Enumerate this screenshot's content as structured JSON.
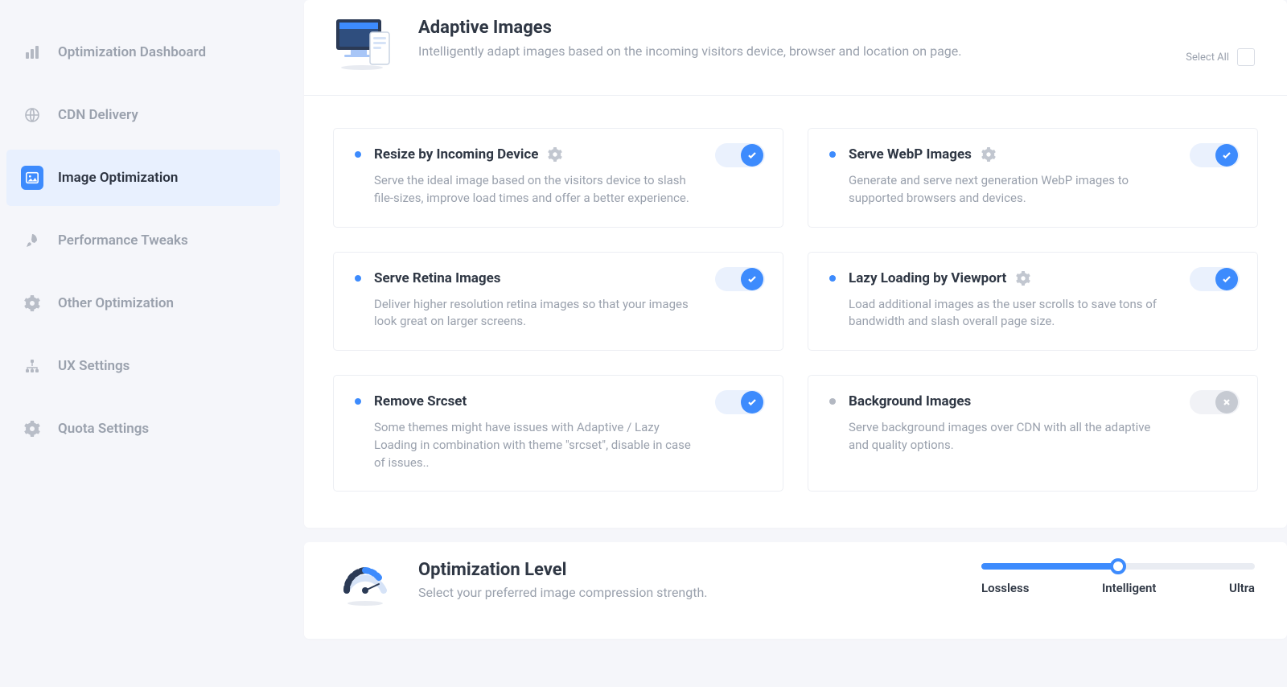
{
  "sidebar": {
    "items": [
      {
        "id": "dashboard",
        "label": "Optimization Dashboard",
        "icon": "bar-chart-icon"
      },
      {
        "id": "cdn",
        "label": "CDN Delivery",
        "icon": "globe-icon"
      },
      {
        "id": "image-opt",
        "label": "Image Optimization",
        "icon": "image-icon",
        "active": true
      },
      {
        "id": "perf",
        "label": "Performance Tweaks",
        "icon": "rocket-icon"
      },
      {
        "id": "other",
        "label": "Other Optimization",
        "icon": "gear-icon"
      },
      {
        "id": "ux",
        "label": "UX Settings",
        "icon": "sitemap-icon"
      },
      {
        "id": "quota",
        "label": "Quota Settings",
        "icon": "gear-icon"
      }
    ]
  },
  "section": {
    "title": "Adaptive Images",
    "subtitle": "Intelligently adapt images based on the incoming visitors device, browser and location on page.",
    "select_all_label": "Select All"
  },
  "cards": [
    {
      "id": "resize-device",
      "title": "Resize by Incoming Device",
      "desc": "Serve the ideal image based on the visitors device to slash file-sizes, improve load times and offer a better experience.",
      "enabled": true,
      "has_gear": true
    },
    {
      "id": "webp",
      "title": "Serve WebP Images",
      "desc": "Generate and serve next generation WebP images to supported browsers and devices.",
      "enabled": true,
      "has_gear": true
    },
    {
      "id": "retina",
      "title": "Serve Retina Images",
      "desc": "Deliver higher resolution retina images so that your images look great on larger screens.",
      "enabled": true,
      "has_gear": false
    },
    {
      "id": "lazy",
      "title": "Lazy Loading by Viewport",
      "desc": "Load additional images as the user scrolls to save tons of bandwidth and slash overall page size.",
      "enabled": true,
      "has_gear": true
    },
    {
      "id": "srcset",
      "title": "Remove Srcset",
      "desc": "Some themes might have issues with Adaptive / Lazy Loading in combination with theme \"srcset\", disable in case of issues..",
      "enabled": true,
      "has_gear": false
    },
    {
      "id": "background",
      "title": "Background Images",
      "desc": "Serve background images over CDN with all the adaptive and quality options.",
      "enabled": false,
      "has_gear": false
    }
  ],
  "optimization_level": {
    "title": "Optimization Level",
    "subtitle": "Select your preferred image compression strength.",
    "labels": [
      "Lossless",
      "Intelligent",
      "Ultra"
    ],
    "value_index": 1
  },
  "colors": {
    "accent": "#3d8bfd",
    "muted": "#9aa1ad",
    "bg": "#f5f6fa"
  }
}
